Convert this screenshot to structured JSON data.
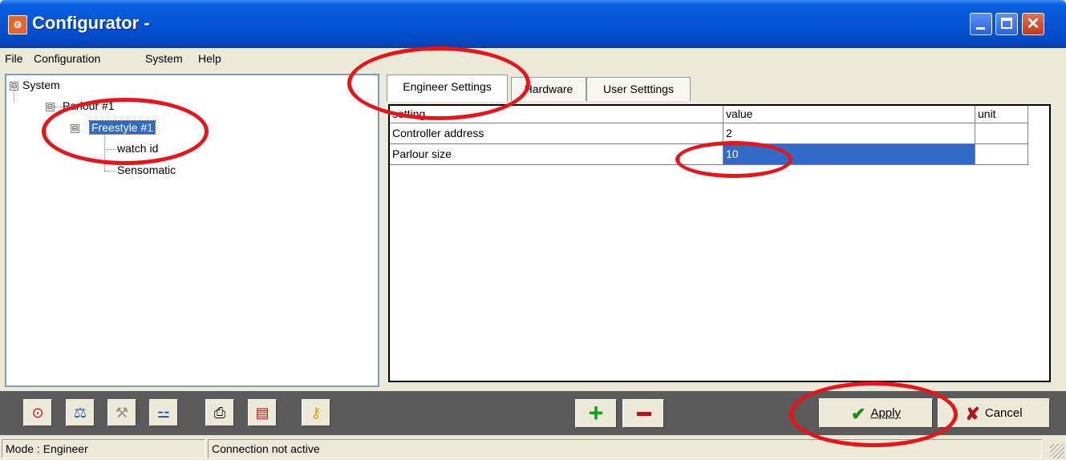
{
  "window": {
    "title": "Configurator -"
  },
  "menu": [
    "File",
    "Configuration",
    "System",
    "Help"
  ],
  "tree": {
    "nodes": [
      {
        "label": "System",
        "expander": "⊟"
      },
      {
        "label": "Parlour #1",
        "expander": "⊟"
      },
      {
        "label": "Freestyle #1",
        "expander": "⊟",
        "selected": true
      },
      {
        "label": "watch id"
      },
      {
        "label": "Sensomatic"
      }
    ]
  },
  "tabs": [
    "Engineer Settings",
    "Hardware",
    "User Setttings"
  ],
  "grid": {
    "headers": [
      "setting",
      "value",
      "unit"
    ],
    "rows": [
      [
        "Controller address",
        "2",
        ""
      ],
      [
        "Parlour size",
        "10",
        ""
      ]
    ]
  },
  "toolbar": {
    "icons": [
      "clock-icon",
      "scale-icon",
      "tools-icon",
      "network-icon",
      "printer-icon",
      "save-icon",
      "key-icon"
    ],
    "plus_label": "+",
    "apply_label": "Apply",
    "cancel_label": "Cancel"
  },
  "status": {
    "mode": "Mode : Engineer",
    "connection": "Connection not active"
  },
  "colors": {
    "annotation": "#E8141A",
    "selection": "#316AC5",
    "titlebar": "#0554D6"
  }
}
